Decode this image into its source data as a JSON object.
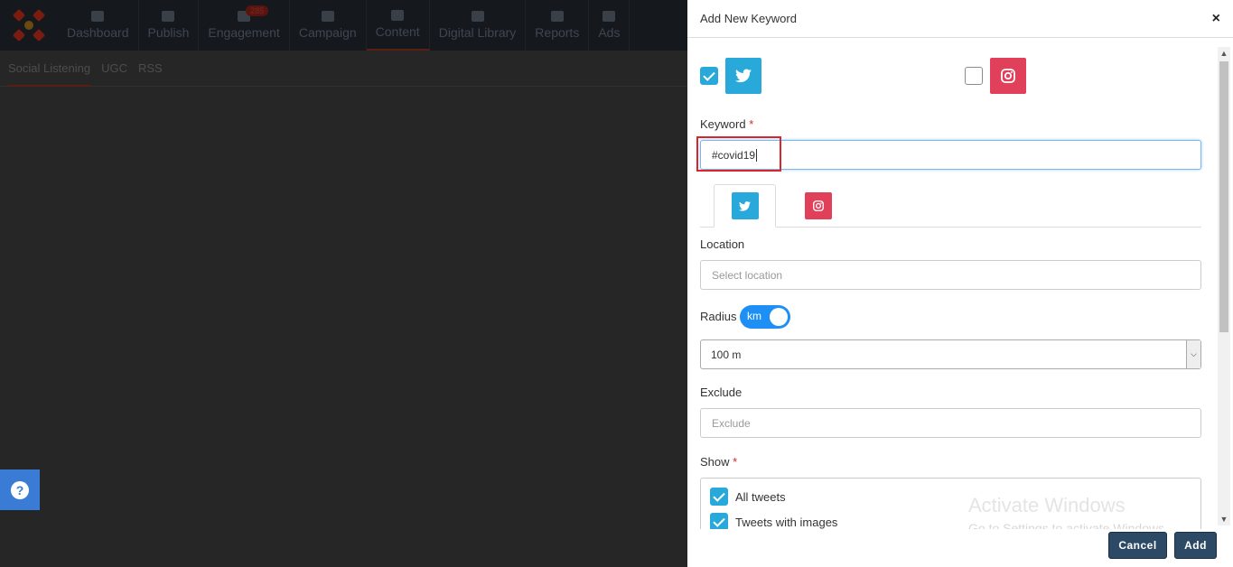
{
  "nav": {
    "items": [
      {
        "label": "Dashboard",
        "icon": "home-icon"
      },
      {
        "label": "Publish",
        "icon": "edit-icon"
      },
      {
        "label": "Engagement",
        "icon": "envelope-icon",
        "badge": "285"
      },
      {
        "label": "Campaign",
        "icon": "target-icon"
      },
      {
        "label": "Content",
        "icon": "list-icon"
      },
      {
        "label": "Digital Library",
        "icon": "briefcase-icon"
      },
      {
        "label": "Reports",
        "icon": "bar-chart-icon"
      },
      {
        "label": "Ads",
        "icon": "paper-plane-icon"
      }
    ],
    "active": "Content"
  },
  "subnav": {
    "items": [
      "Social Listening",
      "UGC",
      "RSS"
    ],
    "active": "Social Listening"
  },
  "modal": {
    "title": "Add New Keyword",
    "close_label": "×",
    "networks": [
      {
        "name": "twitter",
        "checked": true,
        "color": "#29a9d9"
      },
      {
        "name": "instagram",
        "checked": false,
        "color": "#e1405b"
      }
    ],
    "keyword": {
      "label": "Keyword",
      "required_mark": "*",
      "value": "#covid19"
    },
    "location": {
      "label": "Location",
      "placeholder": "Select location"
    },
    "radius": {
      "label": "Radius",
      "unit": "km",
      "toggle_on": true,
      "selected": "100 m"
    },
    "exclude": {
      "label": "Exclude",
      "placeholder": "Exclude"
    },
    "show": {
      "label": "Show",
      "required_mark": "*",
      "options": [
        {
          "label": "All tweets",
          "checked": true
        },
        {
          "label": "Tweets with images",
          "checked": true
        }
      ]
    },
    "watermark": {
      "line1": "Activate Windows",
      "line2": "Go to Settings to activate Windows."
    },
    "footer": {
      "cancel_label": "Cancel",
      "add_label": "Add"
    }
  },
  "colors": {
    "twitter": "#29a9d9",
    "instagram": "#e1405b",
    "button": "#2c4a66",
    "highlight": "#d9262b"
  }
}
